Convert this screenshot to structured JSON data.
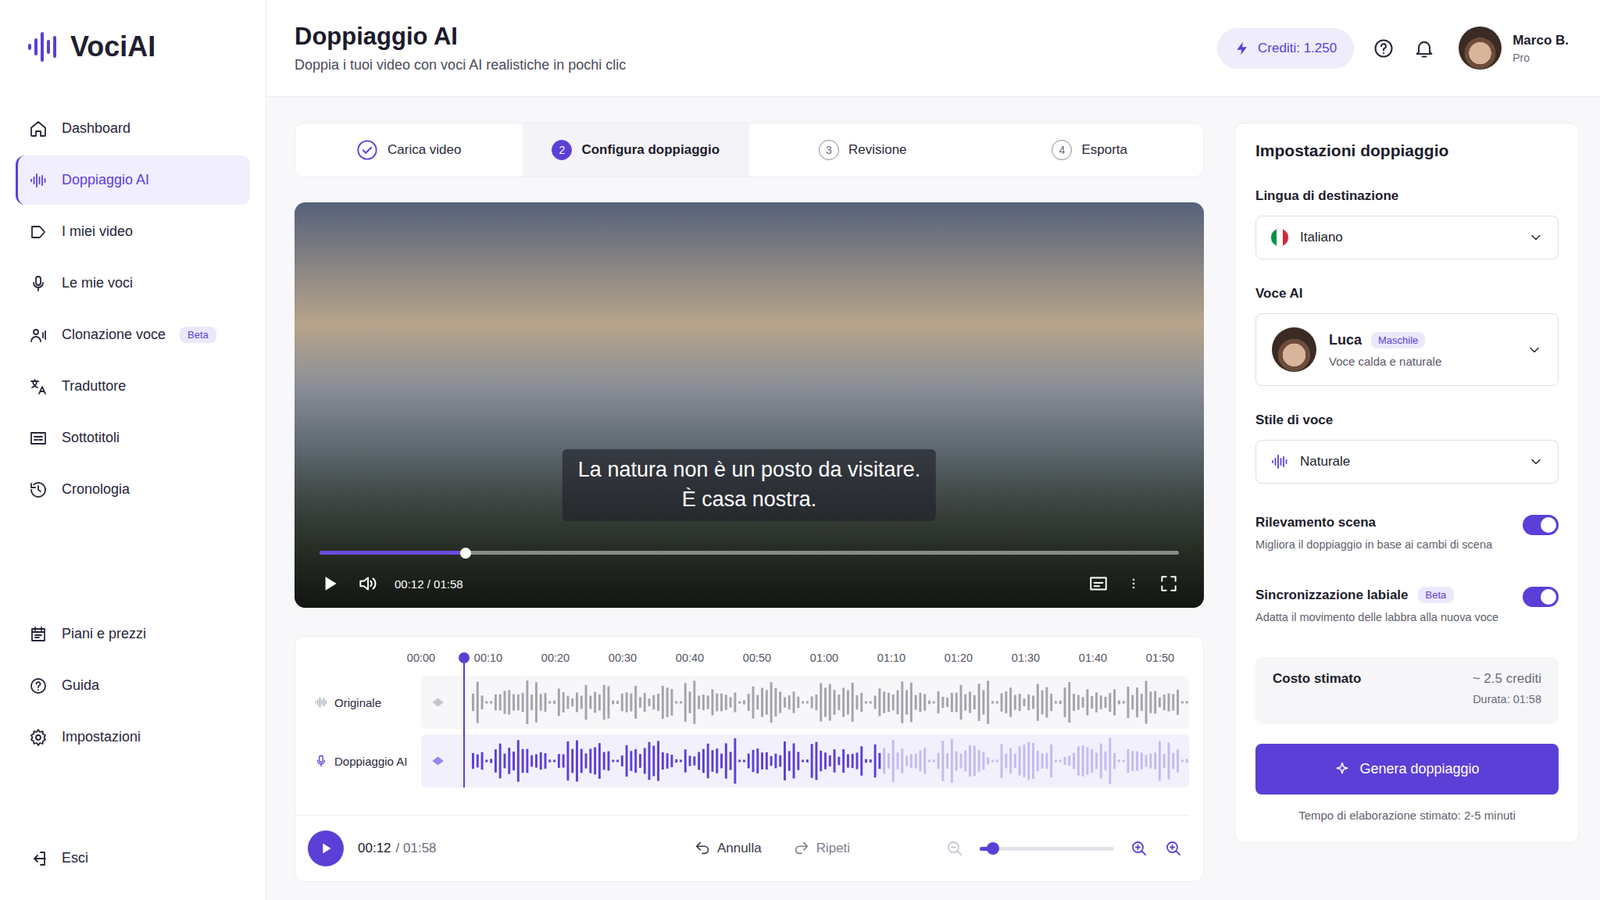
{
  "brand": {
    "name": "VociAI"
  },
  "header": {
    "title": "Doppiaggio AI",
    "subtitle": "Doppia i tuoi video con voci AI realistiche in pochi clic",
    "credits": "Crediti: 1.250",
    "user": {
      "name": "Marco B.",
      "plan": "Pro"
    }
  },
  "sidebar": {
    "items": [
      {
        "label": "Dashboard",
        "badge": null,
        "selected": false
      },
      {
        "label": "Doppiaggio AI",
        "badge": null,
        "selected": true
      },
      {
        "label": "I miei video",
        "badge": null,
        "selected": false
      },
      {
        "label": "Le mie voci",
        "badge": null,
        "selected": false
      },
      {
        "label": "Clonazione voce",
        "badge": "Beta",
        "selected": false
      },
      {
        "label": "Traduttore",
        "badge": null,
        "selected": false
      },
      {
        "label": "Sottotitoli",
        "badge": null,
        "selected": false
      },
      {
        "label": "Cronologia",
        "badge": null,
        "selected": false
      }
    ],
    "bottom": [
      {
        "label": "Piani e prezzi",
        "selected": false
      },
      {
        "label": "Guida",
        "selected": false
      },
      {
        "label": "Impostazioni",
        "selected": false
      }
    ],
    "logout": "Esci"
  },
  "steps": [
    {
      "label": "Carica video",
      "number": null,
      "done": true,
      "selected": false
    },
    {
      "label": "Configura doppiaggio",
      "number": "2",
      "done": false,
      "selected": true
    },
    {
      "label": "Revisione",
      "number": "3",
      "done": false,
      "selected": false
    },
    {
      "label": "Esporta",
      "number": "4",
      "done": false,
      "selected": false
    }
  ],
  "player": {
    "subtitle": [
      "La natura non è un posto da visitare.",
      "È casa nostra."
    ],
    "level": 0.17,
    "time": "00:12 / 01:58"
  },
  "timeline": {
    "ticks": [
      "00:00",
      "00:10",
      "00:20",
      "00:30",
      "00:40",
      "00:50",
      "01:00",
      "01:10",
      "01:20",
      "01:30",
      "01:40",
      "01:50"
    ],
    "playhead": 0.055,
    "tracks": [
      {
        "label": "Originale",
        "level": 1,
        "color": "#a3a3ad"
      },
      {
        "label": "Doppiaggio AI",
        "level": 0.6,
        "color": "#5b3fd6"
      }
    ]
  },
  "transport": {
    "current": "00:12",
    "total": "/ 01:58",
    "undo": {
      "label": "Annulla",
      "disabled": false
    },
    "redo": {
      "label": "Ripeti",
      "disabled": true
    },
    "zoom": 0.1
  },
  "settings": {
    "title": "Impostazioni doppiaggio",
    "language": {
      "label": "Lingua di destinazione",
      "value": "Italiano"
    },
    "voice": {
      "label": "Voce AI",
      "name": "Luca",
      "tag": "Maschile",
      "description": "Voce calda e naturale"
    },
    "style": {
      "label": "Stile di voce",
      "value": "Naturale"
    },
    "toggles": [
      {
        "label": "Rilevamento scena",
        "badge": null,
        "description": "Migliora il doppiaggio in base ai cambi di scena",
        "on": true
      },
      {
        "label": "Sincronizzazione labiale",
        "badge": "Beta",
        "description": "Adatta il movimento delle labbra alla nuova voce",
        "on": true
      }
    ],
    "cost": {
      "label": "Costo stimato",
      "value": "~ 2.5 crediti",
      "duration": "Durata: 01:58"
    },
    "button": "Genera doppiaggio",
    "note": "Tempo di elaborazione stimato: 2-5 minuti"
  }
}
